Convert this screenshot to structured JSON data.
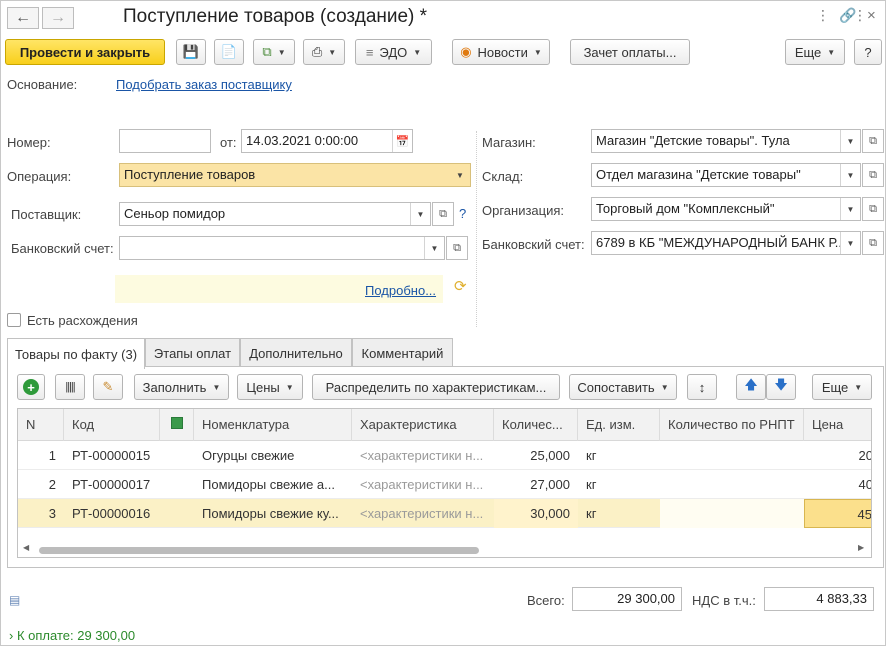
{
  "window": {
    "title": "Поступление товаров (создание) *",
    "icons": [
      "menu-dots-icon",
      "link-icon",
      "more-icon",
      "close-icon"
    ]
  },
  "toolbar": {
    "post_close": "Провести и закрыть",
    "edo": "ЭДО",
    "news": "Новости",
    "payment_offset": "Зачет оплаты...",
    "more": "Еще",
    "help": "?"
  },
  "basis": {
    "label": "Основание:",
    "link": "Подобрать заказ поставщику"
  },
  "form": {
    "number_label": "Номер:",
    "number_value": "",
    "date_label": "от:",
    "date_value": "14.03.2021  0:00:00",
    "operation_label": "Операция:",
    "operation_value": "Поступление товаров",
    "supplier_label": "Поставщик:",
    "supplier_value": "Сеньор помидор",
    "bank_account_label": "Банковский счет:",
    "bank_account_value": "",
    "details_link": "Подробно...",
    "store_label": "Магазин:",
    "store_value": "Магазин \"Детские товары\". Тула",
    "warehouse_label": "Склад:",
    "warehouse_value": "Отдел магазина \"Детские товары\"",
    "org_label": "Организация:",
    "org_value": "Торговый дом \"Комплексный\"",
    "org_bank_label": "Банковский счет:",
    "org_bank_value": "6789 в КБ \"МЕЖДУНАРОДНЫЙ БАНК Р...",
    "discrepancy_label": "Есть расхождения"
  },
  "tabs": [
    "Товары по факту (3)",
    "Этапы оплат",
    "Дополнительно",
    "Комментарий"
  ],
  "grid_toolbar": {
    "fill": "Заполнить",
    "prices": "Цены",
    "distribute": "Распределить по характеристикам...",
    "compare": "Сопоставить",
    "more": "Еще"
  },
  "table": {
    "columns": [
      "N",
      "Код",
      "",
      "Номенклатура",
      "Характеристика",
      "Количес...",
      "Ед. изм.",
      "Количество по РНПТ",
      "Цена"
    ],
    "rows": [
      {
        "n": "1",
        "code": "РТ-00000015",
        "name": "Огурцы свежие",
        "char": "<характеристики н...",
        "qty": "25,000",
        "unit": "кг",
        "rnpt": "",
        "price": "20"
      },
      {
        "n": "2",
        "code": "РТ-00000017",
        "name": "Помидоры свежие а...",
        "char": "<характеристики н...",
        "qty": "27,000",
        "unit": "кг",
        "rnpt": "",
        "price": "40"
      },
      {
        "n": "3",
        "code": "РТ-00000016",
        "name": "Помидоры свежие ку...",
        "char": "<характеристики н...",
        "qty": "30,000",
        "unit": "кг",
        "rnpt": "",
        "price": "45"
      }
    ]
  },
  "totals": {
    "total_label": "Всего:",
    "total_value": "29 300,00",
    "vat_label": "НДС в т.ч.:",
    "vat_value": "4 883,33",
    "to_pay": "К оплате: 29 300,00"
  },
  "colors": {
    "primary_button": "#f8cf1b",
    "selected_row": "#fbf1c6",
    "link": "#1a55a6",
    "pay_text": "#2b8a2b"
  }
}
